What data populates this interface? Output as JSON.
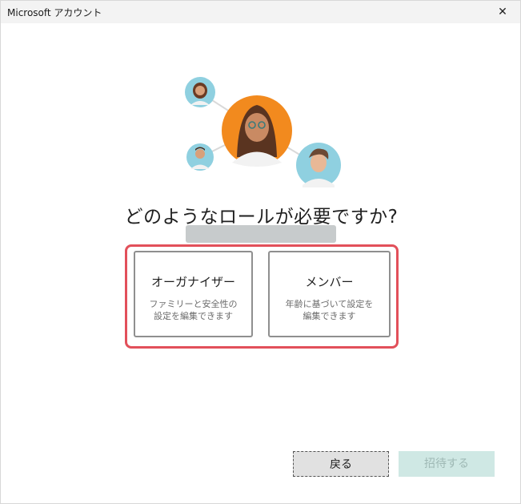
{
  "window": {
    "title": "Microsoft アカウント",
    "close_glyph": "✕"
  },
  "main": {
    "question": "どのようなロールが必要ですか?",
    "roles": [
      {
        "title": "オーガナイザー",
        "description": "ファミリーと安全性の\n設定を編集できます"
      },
      {
        "title": "メンバー",
        "description": "年齢に基づいて設定を\n編集できます"
      }
    ]
  },
  "footer": {
    "back_label": "戻る",
    "invite_label": "招待する"
  },
  "colors": {
    "highlight": "#e2505a",
    "accent_avatar_main": "#f28a1e",
    "accent_avatar_small": "#8fd0e0",
    "invite_disabled_bg": "#cfe8e4"
  },
  "icons": {
    "close": "close-icon",
    "family": "family-avatars-illustration"
  }
}
